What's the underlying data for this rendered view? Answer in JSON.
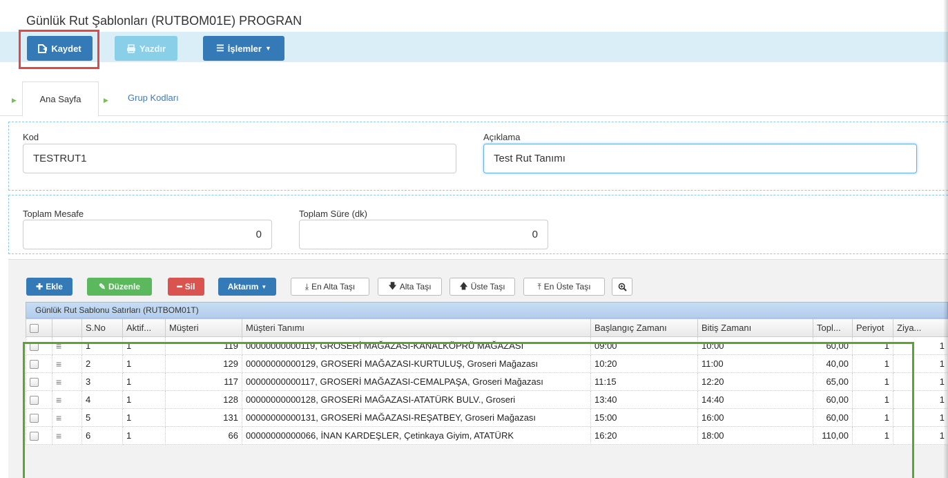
{
  "window": {
    "title": "Günlük Rut Şablonları (RUTBOM01E) PROGRAN"
  },
  "toolbar": {
    "save_label": "Kaydet",
    "print_label": "Yazdır",
    "operations_label": "İşlemler"
  },
  "tabs": [
    {
      "label": "Ana Sayfa",
      "active": true
    },
    {
      "label": "Grup Kodları",
      "active": false
    }
  ],
  "form": {
    "kod": {
      "label": "Kod",
      "value": "TESTRUT1"
    },
    "aciklama": {
      "label": "Açıklama",
      "value": "Test Rut Tanımı"
    },
    "toplam_mesafe": {
      "label": "Toplam Mesafe",
      "value": "0"
    },
    "toplam_sure": {
      "label": "Toplam Süre (dk)",
      "value": "0"
    }
  },
  "grid_toolbar": {
    "add": "Ekle",
    "edit": "Düzenle",
    "delete": "Sil",
    "transfer": "Aktarım",
    "move_bottom": "En Alta Taşı",
    "move_down": "Alta Taşı",
    "move_up": "Üste Taşı",
    "move_top": "En Üste Taşı"
  },
  "grid": {
    "caption": "Günlük Rut Sablonu Satırları (RUTBOM01T)",
    "columns": [
      "S.No",
      "Aktif...",
      "Müşteri",
      "Müşteri Tanımı",
      "Başlangıç Zamanı",
      "Bitiş Zamanı",
      "Topl...",
      "Periyot",
      "Ziya..."
    ],
    "rows": [
      [
        "1",
        "1",
        "119",
        "00000000000119, GROSERİ MAĞAZASI-KANALKÖPRÜ MAĞAZASI",
        "09:00",
        "10:00",
        "60,00",
        "1",
        "1"
      ],
      [
        "2",
        "1",
        "129",
        "00000000000129, GROSERİ MAĞAZASI-KURTULUŞ, Groseri Mağazası",
        "10:20",
        "11:00",
        "40,00",
        "1",
        "1"
      ],
      [
        "3",
        "1",
        "117",
        "00000000000117, GROSERİ MAĞAZASI-CEMALPAŞA, Groseri Mağazası",
        "11:15",
        "12:20",
        "65,00",
        "1",
        "1"
      ],
      [
        "4",
        "1",
        "128",
        "00000000000128, GROSERİ MAĞAZASI-ATATÜRK BULV., Groseri",
        "13:40",
        "14:40",
        "60,00",
        "1",
        "1"
      ],
      [
        "5",
        "1",
        "131",
        "00000000000131, GROSERİ MAĞAZASI-REŞATBEY, Groseri Mağazası",
        "15:00",
        "16:00",
        "60,00",
        "1",
        "1"
      ],
      [
        "6",
        "1",
        "66",
        "00000000000066, İNAN KARDEŞLER, Çetinkaya Giyim, ATATÜRK",
        "16:20",
        "18:00",
        "110,00",
        "1",
        "1"
      ]
    ]
  }
}
